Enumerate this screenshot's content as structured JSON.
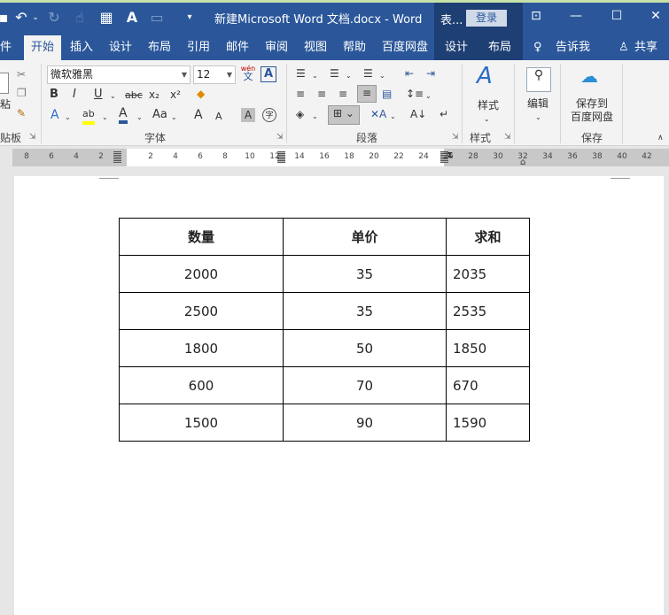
{
  "titlebar": {
    "title": "新建Microsoft Word 文档.docx  -  Word",
    "context_label": "表...",
    "login": "登录"
  },
  "tabs": {
    "file": "件",
    "home": "开始",
    "insert": "插入",
    "design": "设计",
    "layout": "布局",
    "references": "引用",
    "mailings": "邮件",
    "review": "审阅",
    "view": "视图",
    "help": "帮助",
    "baidu": "百度网盘",
    "table_design": "设计",
    "table_layout": "布局",
    "tell_me": "告诉我",
    "share": "共享"
  },
  "ribbon": {
    "clipboard_paste": "粘",
    "clipboard_label": "贴板",
    "font_name": "微软雅黑",
    "font_size": "12",
    "wen_top": "wén",
    "wen_bottom": "文",
    "font_group_label": "字体",
    "paragraph_group_label": "段落",
    "styles_button": "样式",
    "styles_group_label": "样式",
    "edit_button": "编辑",
    "save_to_line1": "保存到",
    "save_to_line2": "百度网盘",
    "save_group_label": "保存",
    "bold": "B",
    "italic": "I",
    "underline": "U",
    "strike": "abc",
    "subscript": "x₂",
    "superscript": "x²",
    "text_effects": "A",
    "highlight": "ab",
    "font_color": "A",
    "change_case": "Aa",
    "grow_font": "A",
    "shrink_font": "A",
    "char_shading": "A",
    "enclose_char": "字"
  },
  "ruler": {
    "left_numbers": [
      "8",
      "6",
      "4",
      "2"
    ],
    "numbers": [
      "2",
      "4",
      "6",
      "8",
      "10",
      "12",
      "14",
      "16",
      "18",
      "20",
      "22",
      "24",
      "26",
      "28",
      "30",
      "32",
      "34",
      "36",
      "38",
      "40",
      "42"
    ]
  },
  "table": {
    "headers": [
      "数量",
      "单价",
      "求和"
    ],
    "rows": [
      [
        "2000",
        "35",
        "2035"
      ],
      [
        "2500",
        "35",
        "2535"
      ],
      [
        "1800",
        "50",
        "1850"
      ],
      [
        "600",
        "70",
        "670"
      ],
      [
        "1500",
        "90",
        "1590"
      ]
    ]
  },
  "colors": {
    "accent": "#2b579a",
    "context_tab": "#1e3f73",
    "ribbon_bg": "#f3f3f3"
  }
}
